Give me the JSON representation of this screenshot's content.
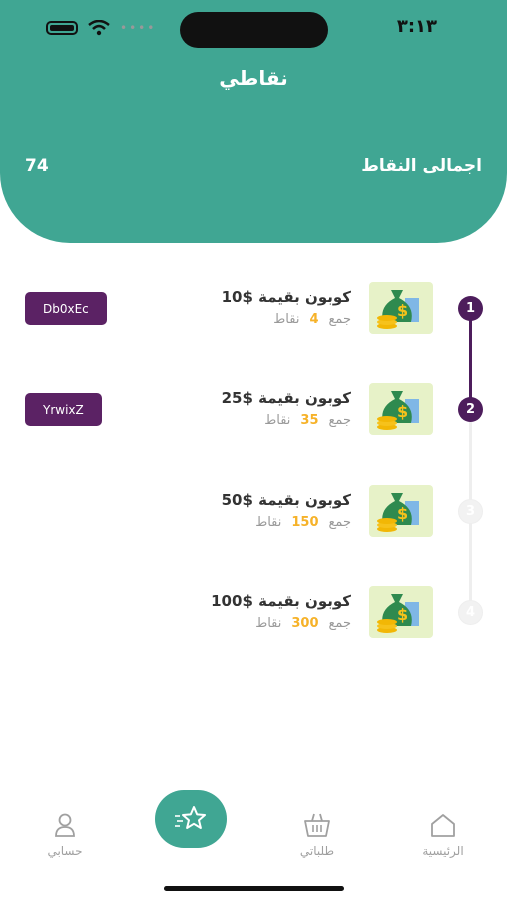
{
  "status": {
    "time": "٣:١٣"
  },
  "header": {
    "title": "نقاطي",
    "total_label": "اجمالى النقاط",
    "total_value": "74"
  },
  "coupons": [
    {
      "step": "1",
      "title": "كوبون بقيمة $10",
      "collect": "جمع",
      "points": "4",
      "unit": "نقاط",
      "code": "Db0xEc",
      "completed": true
    },
    {
      "step": "2",
      "title": "كوبون بقيمة $25",
      "collect": "جمع",
      "points": "35",
      "unit": "نقاط",
      "code": "YrwixZ",
      "completed": true
    },
    {
      "step": "3",
      "title": "كوبون بقيمة $50",
      "collect": "جمع",
      "points": "150",
      "unit": "نقاط",
      "code": "",
      "completed": false
    },
    {
      "step": "4",
      "title": "كوبون بقيمة $100",
      "collect": "جمع",
      "points": "300",
      "unit": "نقاط",
      "code": "",
      "completed": false
    }
  ],
  "tabbar": {
    "home": "الرئيسية",
    "orders": "طلباتي",
    "points_icon": "star-icon",
    "account": "حسابي"
  },
  "colors": {
    "primary": "#40a693",
    "accent": "#4d1d5c",
    "points": "#f6b229"
  }
}
